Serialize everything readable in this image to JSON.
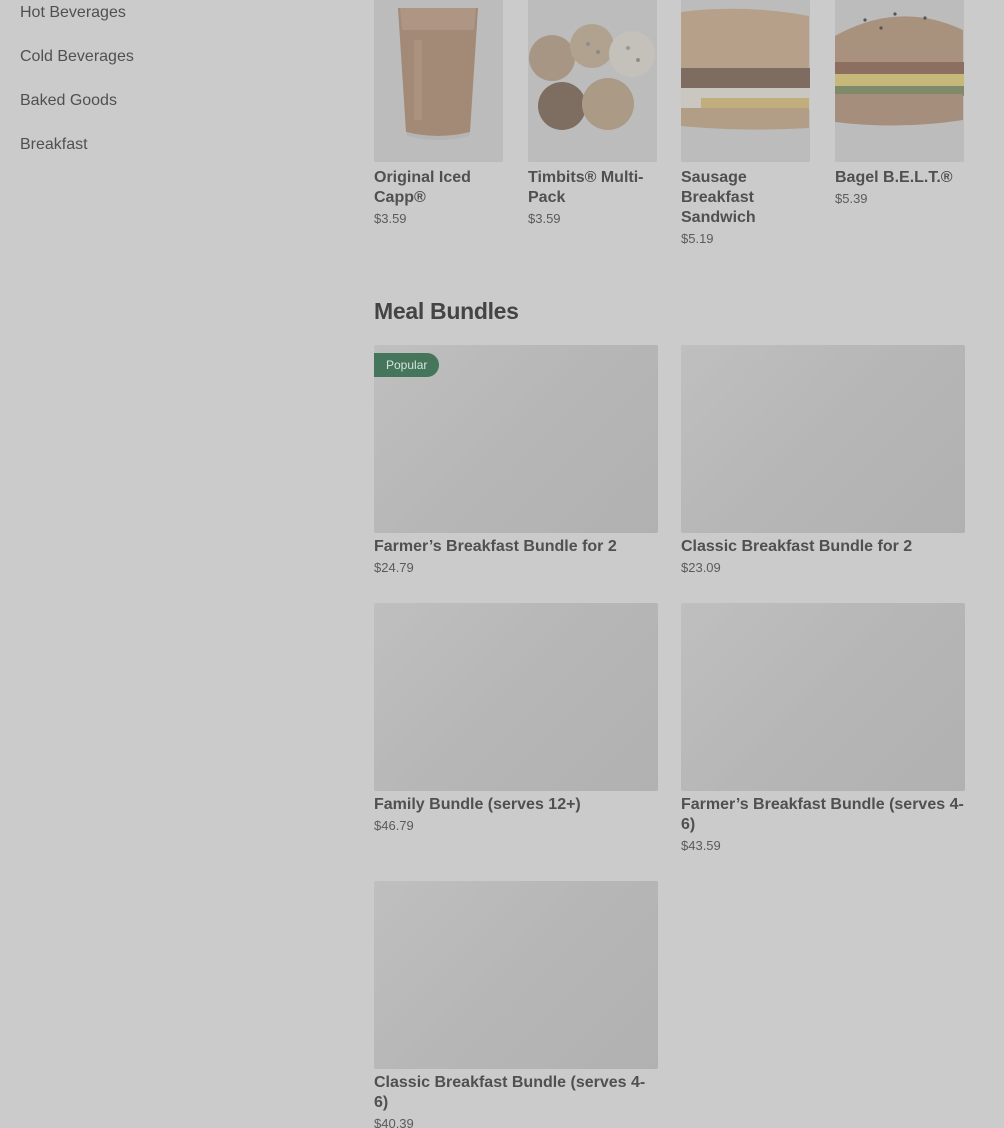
{
  "sidebar": {
    "items": [
      {
        "label": "Hot Beverages"
      },
      {
        "label": "Cold Beverages"
      },
      {
        "label": "Baked Goods"
      },
      {
        "label": "Breakfast"
      }
    ]
  },
  "featured": [
    {
      "name": "Original Iced Capp®",
      "price": "$3.59",
      "image": "iced-capp-drink"
    },
    {
      "name": "Timbits® Multi-Pack",
      "price": "$3.59",
      "image": "timbits-pack"
    },
    {
      "name": "Sausage Breakfast Sandwich",
      "price": "$5.19",
      "image": "sausage-sandwich"
    },
    {
      "name": "Bagel B.E.L.T.®",
      "price": "$5.39",
      "image": "bagel-belt"
    }
  ],
  "meal_bundles": {
    "title": "Meal Bundles",
    "items": [
      {
        "name": "Farmer’s Breakfast Bundle for 2",
        "price": "$24.79",
        "badge": "Popular"
      },
      {
        "name": "Classic Breakfast Bundle for 2",
        "price": "$23.09"
      },
      {
        "name": "Family Bundle (serves 12+)",
        "price": "$46.79"
      },
      {
        "name": "Farmer’s Breakfast Bundle (serves 4-6)",
        "price": "$43.59"
      },
      {
        "name": "Classic Breakfast Bundle (serves 4-6)",
        "price": "$40.39"
      }
    ]
  },
  "colors": {
    "badge": "#45755a",
    "overlay": "#cbcbcb"
  }
}
